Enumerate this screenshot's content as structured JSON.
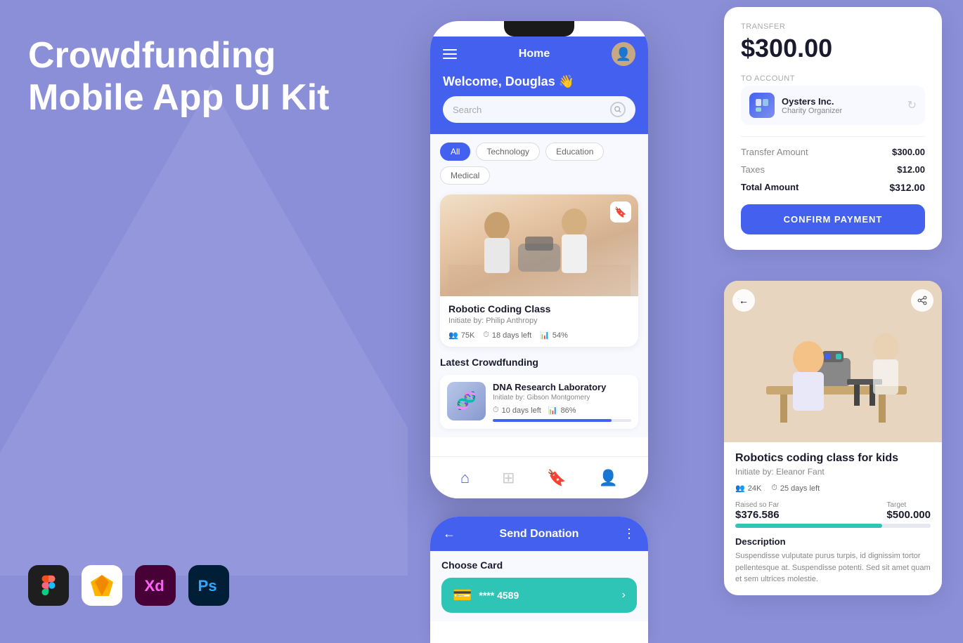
{
  "app": {
    "title": "Crowdfunding Mobile App UI Kit",
    "title_line1": "Crowdfunding",
    "title_line2": "Mobile App UI Kit"
  },
  "phone1": {
    "nav_title": "Home",
    "welcome_text": "Welcome, Douglas 👋",
    "search_placeholder": "Search",
    "tabs": [
      "All",
      "Technology",
      "Education",
      "Medical"
    ],
    "featured": {
      "title": "Robotic Coding Class",
      "subtitle": "Initiate by: Philip Anthropy",
      "backers": "75K",
      "days_left": "18 days left",
      "percent": "54%",
      "progress": 54
    },
    "section_title": "Latest Crowdfunding",
    "crowdfund_item": {
      "title": "DNA Research Laboratory",
      "subtitle": "Initiate by: Gibson Montgomery",
      "days_left": "10 days left",
      "percent": "86%",
      "progress": 86
    }
  },
  "transfer_card": {
    "label": "TRANSFER",
    "amount": "$300.00",
    "to_account_label": "TO ACCOUNT",
    "account_name": "Oysters Inc.",
    "account_type": "Charity Organizer",
    "breakdown": {
      "transfer_label": "Transfer Amount",
      "transfer_value": "$300.00",
      "taxes_label": "Taxes",
      "taxes_value": "$12.00",
      "total_label": "Total Amount",
      "total_value": "$312.00"
    },
    "confirm_btn": "CONFIRM PAYMENT"
  },
  "detail_card": {
    "title": "Robotics coding class for kids",
    "subtitle": "Initiate by: Eleanor Fant",
    "backers": "24K",
    "days_left": "25 days left",
    "raised_label": "Raised so Far",
    "raised_amount": "$376.586",
    "target_label": "Target",
    "target_amount": "$500.000",
    "progress": 75,
    "description_title": "Description",
    "description_text": "Suspendisse vulputate purus turpis, id dignissim tortor pellentesque at. Suspendisse potenti. Sed sit amet quam et sem ultrices molestie."
  },
  "phone2": {
    "title": "Send Donation",
    "back_icon": "←",
    "more_icon": "⋮",
    "choose_card_label": "Choose Card",
    "card_number": "**** 4589"
  },
  "tools": [
    {
      "name": "Figma",
      "color": "#1e1e1e",
      "icon": "F"
    },
    {
      "name": "Sketch",
      "color": "#ffffff",
      "icon": "S"
    },
    {
      "name": "XD",
      "color": "#470137",
      "icon": "Xd"
    },
    {
      "name": "Photoshop",
      "color": "#001e36",
      "icon": "Ps"
    }
  ],
  "colors": {
    "brand_blue": "#4361ee",
    "teal": "#2ec4b6",
    "bg_purple": "#8b8fd8"
  }
}
